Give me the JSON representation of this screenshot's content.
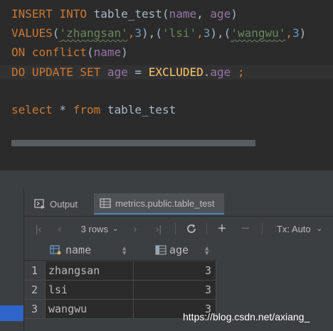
{
  "editor": {
    "line1": {
      "kw1": "INSERT",
      "kw2": "INTO",
      "table": "table_test",
      "open": "(",
      "col1": "name",
      "comma": ", ",
      "col2": "age",
      "close": ")"
    },
    "line2": {
      "kw": "VALUES",
      "open": "(",
      "s1": "'zhangsan'",
      "c1": ",",
      "n1": "3",
      "mid1": "),(",
      "s2": "'lsi'",
      "c2": ",",
      "n2": "3",
      "mid2": "),(",
      "s3": "'wangwu'",
      "c3": ",",
      "n3": "3",
      "close": ")"
    },
    "line3": {
      "kw1": "ON",
      "kw2": "conflict",
      "open": "(",
      "col": "name",
      "close": ")"
    },
    "line4": {
      "kw1": "DO",
      "kw2": "UPDATE",
      "kw3": "SET",
      "col": "age",
      "eq": " = ",
      "excluded": "EXCLUDED",
      "dot": ".",
      "col2": "age",
      "semi": " ;"
    },
    "line6": {
      "kw1": "select",
      "star": " * ",
      "kw2": "from",
      "table": "table_test"
    }
  },
  "results": {
    "tabs": [
      {
        "label": "Output",
        "icon": "output-icon"
      },
      {
        "label": "metrics.public.table_test",
        "icon": "table-icon"
      }
    ],
    "toolbar": {
      "rows_label": "3 rows",
      "tx_label": "Tx: Auto"
    },
    "columns": [
      {
        "name": "name",
        "icon": "key-column-icon"
      },
      {
        "name": "age",
        "icon": "column-icon"
      }
    ],
    "rows": [
      {
        "num": "1",
        "name": "zhangsan",
        "age": "3"
      },
      {
        "num": "2",
        "name": "lsi",
        "age": "3"
      },
      {
        "num": "3",
        "name": "wangwu",
        "age": "3"
      }
    ]
  },
  "watermark": "https://blog.csdn.net/axiang_",
  "colors": {
    "keyword": "#cc7832",
    "string": "#6a8759",
    "number": "#6897bb",
    "column": "#9876aa",
    "constant": "#ffc66d",
    "selection": "#2f65ca"
  }
}
